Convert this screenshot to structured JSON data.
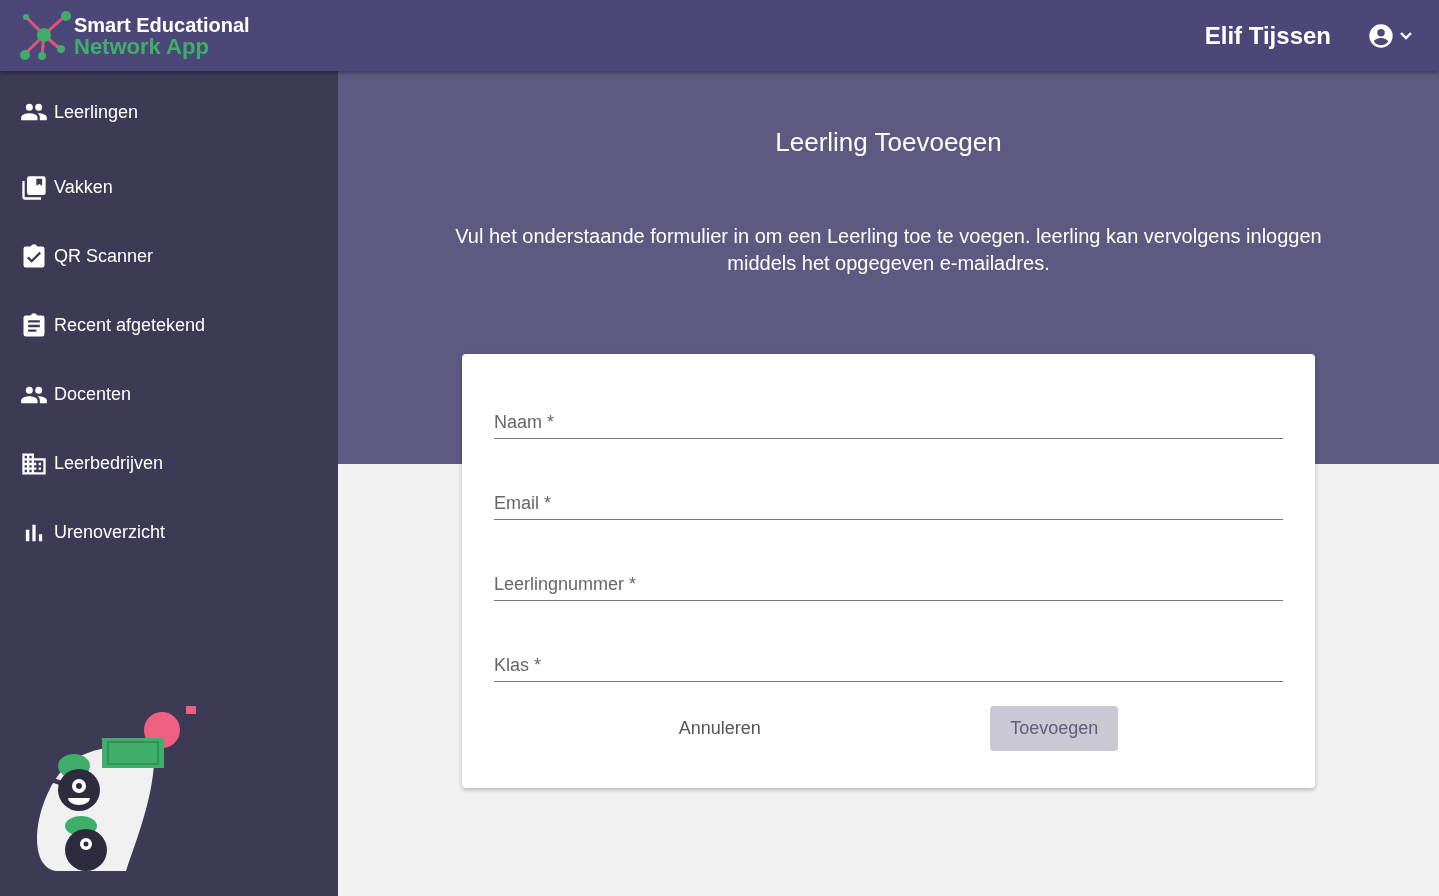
{
  "app": {
    "logo_line_1": "Smart Educational",
    "logo_line_2": "Network App"
  },
  "user": {
    "name": "Elif Tijssen"
  },
  "sidebar": {
    "items": [
      {
        "label": "Leerlingen"
      },
      {
        "label": "Vakken"
      },
      {
        "label": "QR Scanner"
      },
      {
        "label": "Recent afgetekend"
      },
      {
        "label": "Docenten"
      },
      {
        "label": "Leerbedrijven"
      },
      {
        "label": "Urenoverzicht"
      }
    ]
  },
  "page": {
    "title": "Leerling Toevoegen",
    "description": "Vul het onderstaande formulier in om een Leerling toe te voegen. leerling kan vervolgens inloggen middels het opgegeven e-mailadres."
  },
  "form": {
    "fields": [
      {
        "placeholder": "Naam *"
      },
      {
        "placeholder": "Email *"
      },
      {
        "placeholder": "Leerlingnummer *"
      },
      {
        "placeholder": "Klas *"
      }
    ],
    "buttons": [
      {
        "label": "Annuleren",
        "kind": "text",
        "disabled": false
      },
      {
        "label": "Toevoegen",
        "kind": "raised",
        "disabled": true
      }
    ]
  }
}
